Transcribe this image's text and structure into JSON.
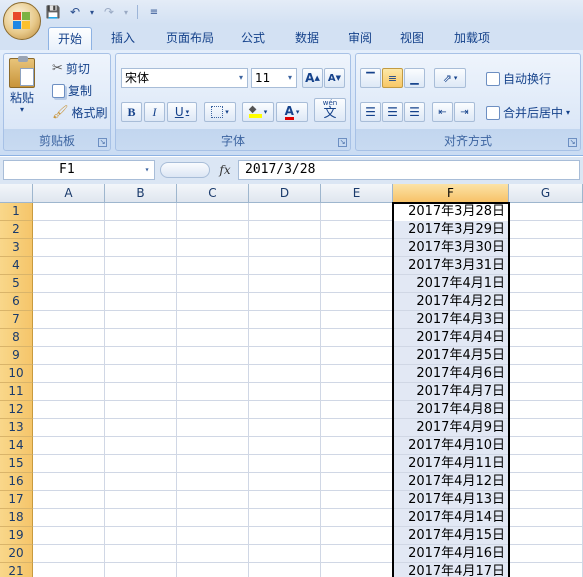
{
  "title_bar": {
    "quick_access": [
      "save-icon",
      "undo-icon",
      "redo-icon",
      "customize-icon"
    ]
  },
  "tabs": [
    "开始",
    "插入",
    "页面布局",
    "公式",
    "数据",
    "审阅",
    "视图",
    "加载项"
  ],
  "active_tab": "开始",
  "clipboard": {
    "paste": "粘贴",
    "cut": "剪切",
    "copy": "复制",
    "format_painter": "格式刷",
    "group_label": "剪贴板"
  },
  "font": {
    "name": "宋体",
    "size": "11",
    "bold": "B",
    "italic": "I",
    "underline": "U",
    "grow": "A",
    "shrink": "A",
    "color_letter": "A",
    "phonetic_top": "wén",
    "phonetic": "文",
    "group_label": "字体"
  },
  "alignment": {
    "wrap_text": "自动换行",
    "merge_center": "合并后居中",
    "group_label": "对齐方式"
  },
  "formula_bar": {
    "name_box": "F1",
    "fx": "fx",
    "formula": "2017/3/28"
  },
  "columns": [
    "A",
    "B",
    "C",
    "D",
    "E",
    "F",
    "G"
  ],
  "selected_column": "F",
  "rows": [
    "1",
    "2",
    "3",
    "4",
    "5",
    "6",
    "7",
    "8",
    "9",
    "10",
    "11",
    "12",
    "13",
    "14",
    "15",
    "16",
    "17",
    "18",
    "19",
    "20",
    "21"
  ],
  "column_f_values": [
    "2017年3月28日",
    "2017年3月29日",
    "2017年3月30日",
    "2017年3月31日",
    "2017年4月1日",
    "2017年4月2日",
    "2017年4月3日",
    "2017年4月4日",
    "2017年4月5日",
    "2017年4月6日",
    "2017年4月7日",
    "2017年4月8日",
    "2017年4月9日",
    "2017年4月10日",
    "2017年4月11日",
    "2017年4月12日",
    "2017年4月13日",
    "2017年4月14日",
    "2017年4月15日",
    "2017年4月16日",
    "2017年4月17日"
  ],
  "colors": {
    "selection_header": "#f7c268",
    "ribbon": "#dbe7f7",
    "selection_fill": "#e2e8f4"
  }
}
